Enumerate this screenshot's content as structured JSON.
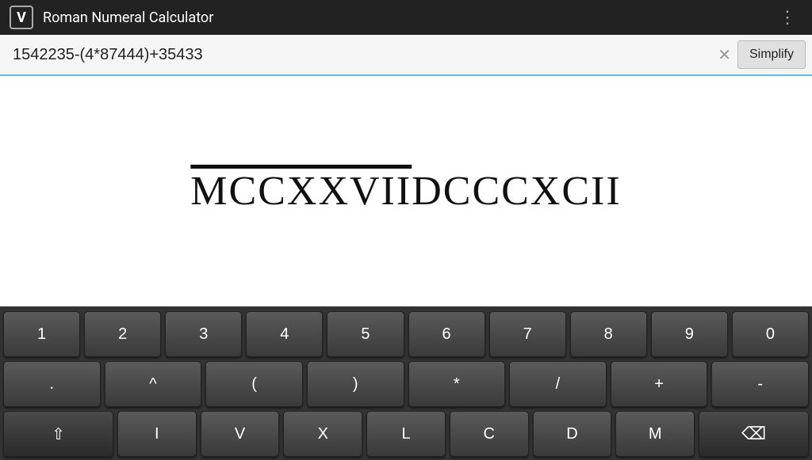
{
  "titlebar": {
    "icon_label": "V",
    "title": "Roman Numeral Calculator",
    "menu_icon": "⋮"
  },
  "input_bar": {
    "expression": "1542235-(4*87444)+35433",
    "clear_icon": "✕",
    "simplify_label": "Simplify"
  },
  "result": {
    "overline_text": "MCCXXVII",
    "plain_text": "DCCCXCII"
  },
  "keyboard": {
    "row_numbers": [
      "1",
      "2",
      "3",
      "4",
      "5",
      "6",
      "7",
      "8",
      "9",
      "0"
    ],
    "row_symbols": [
      ".",
      "^",
      "(",
      ")",
      "*",
      "/",
      "+",
      "-"
    ],
    "row_letters": [
      "I",
      "V",
      "X",
      "L",
      "C",
      "D",
      "M"
    ]
  }
}
